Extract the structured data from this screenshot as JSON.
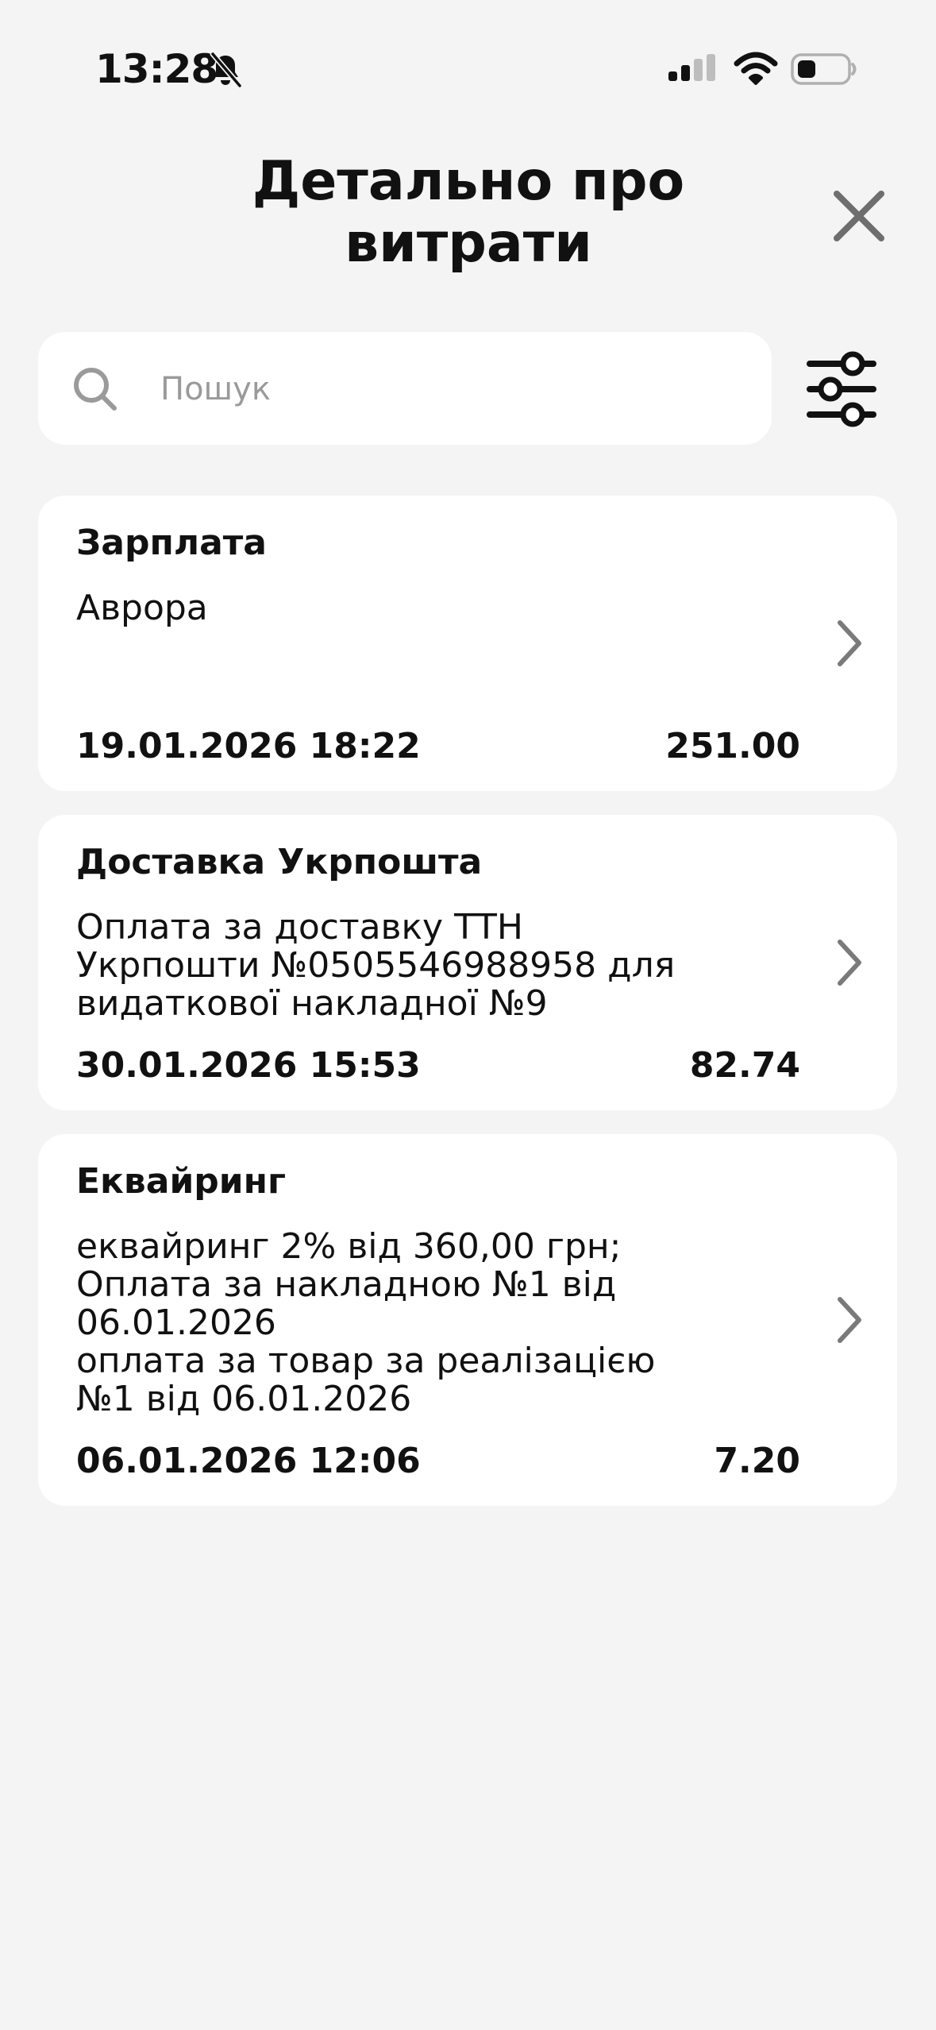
{
  "status_bar": {
    "time": "13:28",
    "icons": [
      "bell-slash-icon",
      "cellular-signal-icon",
      "wifi-icon",
      "battery-icon"
    ]
  },
  "header": {
    "title": "Детально про\nвитрати",
    "close_icon": "close-icon"
  },
  "search": {
    "placeholder": "Пошук",
    "value": "",
    "icon": "search-icon",
    "filter_icon": "sliders-icon"
  },
  "expenses": [
    {
      "title": "Зарплата",
      "description": "Аврора",
      "date": "19.01.2026 18:22",
      "amount": "251.00"
    },
    {
      "title": "Доставка Укрпошта",
      "description": "Оплата за доставку ТТН\nУкрпошти №0505546988958 для\nвидаткової накладної №9",
      "date": "30.01.2026 15:53",
      "amount": "82.74"
    },
    {
      "title": "Еквайринг",
      "description": "еквайринг 2% від 360,00 грн;\nОплата за накладною №1 від\n06.01.2026\nоплата за товар за реалізацією\n№1 від 06.01.2026",
      "date": "06.01.2026 12:06",
      "amount": "7.20"
    }
  ],
  "colors": {
    "background": "#f4f4f4",
    "card": "#ffffff",
    "text": "#111111",
    "placeholder": "#9a9a9a",
    "icon_gray": "#6e6e6e"
  }
}
